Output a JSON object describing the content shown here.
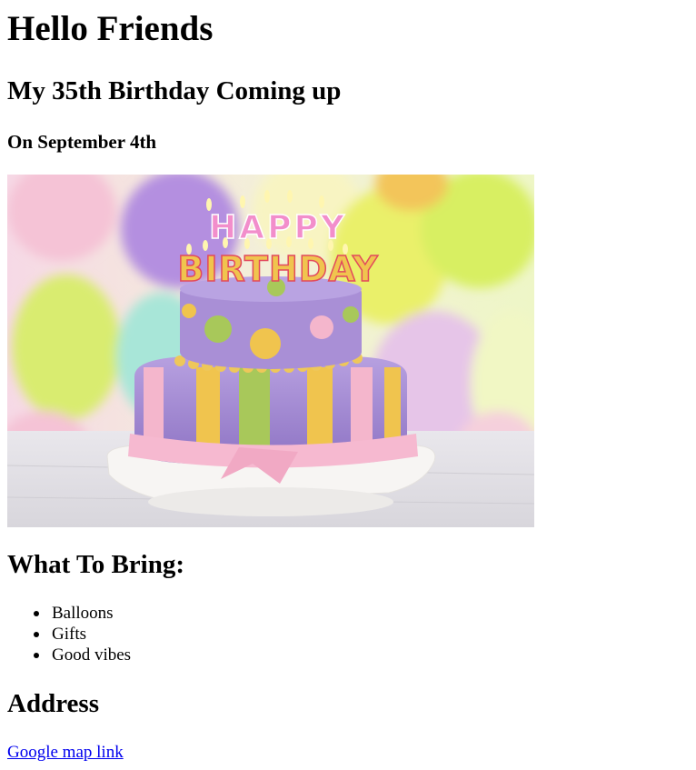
{
  "heading": "Hello Friends",
  "subheading": "My 35th Birthday Coming up",
  "date_line": "On September 4th",
  "image": {
    "candle_text_top": "HAPPY",
    "candle_text_bottom": "BIRTHDAY"
  },
  "bring": {
    "title": "What To Bring:",
    "items": [
      "Balloons",
      "Gifts",
      "Good vibes"
    ]
  },
  "address": {
    "title": "Address",
    "link_text": "Google map link"
  },
  "colors": {
    "link": "#0000ee",
    "cake_purple": "#a98fd6",
    "cake_pink": "#f4b6cc",
    "cake_yellow": "#f0c44e",
    "cake_green": "#a8c85a"
  }
}
